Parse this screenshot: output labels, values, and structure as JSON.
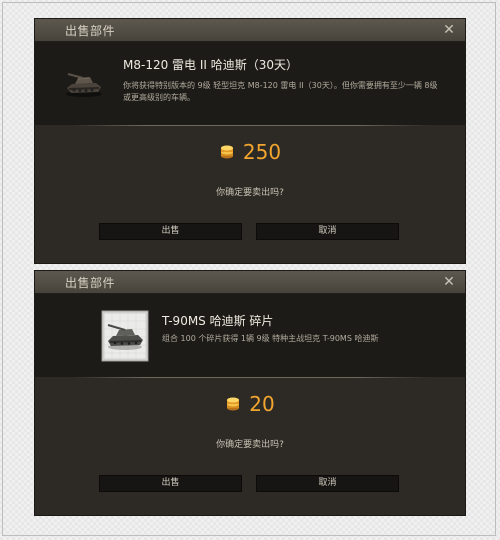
{
  "dialogs": [
    {
      "title": "出售部件",
      "close_glyph": "✕",
      "item": {
        "icon": "tank-icon",
        "name": "M8-120 雷电 II 哈迪斯（30天）",
        "description": "你将获得特别版本的 9级 轻型坦克 M8-120 雷电 II（30天）。但你需要拥有至少一辆 8级 或更高级别的车辆。"
      },
      "price": "250",
      "price_icon": "gold-coin-icon",
      "confirm": "你确定要卖出吗?",
      "sell_label": "出售",
      "cancel_label": "取消"
    },
    {
      "title": "出售部件",
      "close_glyph": "✕",
      "item": {
        "icon": "tank-fragment-card-icon",
        "name": "T-90MS 哈迪斯 碎片",
        "description": "组合 100 个碎片获得 1辆 9级 特种主战坦克 T-90MS 哈迪斯"
      },
      "price": "20",
      "price_icon": "gold-coin-icon",
      "confirm": "你确定要卖出吗?",
      "sell_label": "出售",
      "cancel_label": "取消"
    }
  ],
  "colors": {
    "gold": "#f2a630",
    "panel": "#2d2a25",
    "info_bg": "#1d1b18",
    "titlebar": "#524d45"
  }
}
